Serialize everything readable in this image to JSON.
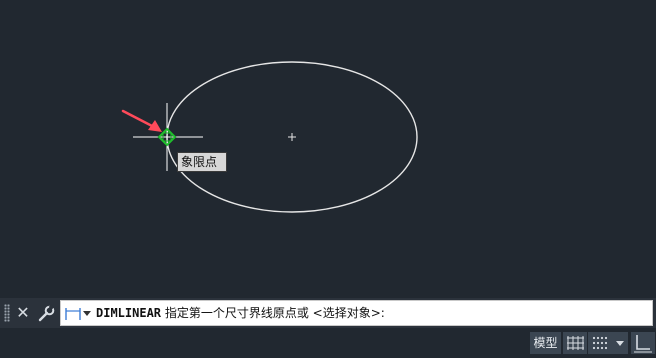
{
  "drawing": {
    "tooltip_text": "象限点",
    "colors": {
      "background": "#212830",
      "ellipse": "#e6e6e6",
      "crosshair": "#ffffff",
      "snap_marker": "#1fbf2c",
      "arrow": "#ff4a5a"
    }
  },
  "command_line": {
    "command_name": "DIMLINEAR",
    "prompt": " 指定第一个尺寸界线原点或 <选择对象>:",
    "icons": {
      "grip": "grip-handle-icon",
      "close": "close-icon",
      "customize": "wrench-icon",
      "recent": "dimension-linear-icon"
    }
  },
  "status_bar": {
    "model_label": "模型",
    "icons": [
      "grid-icon",
      "snap-icon",
      "chevron-down-icon",
      "ortho-icon"
    ]
  }
}
